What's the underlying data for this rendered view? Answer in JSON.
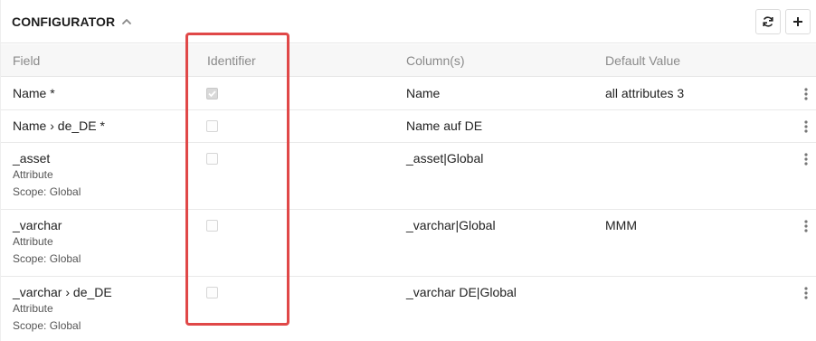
{
  "header": {
    "title": "CONFIGURATOR",
    "collapse_icon": "chevron-up-icon",
    "refresh_icon": "refresh-icon",
    "add_icon": "plus-icon"
  },
  "table": {
    "columns": [
      "Field",
      "Identifier",
      "Column(s)",
      "Default Value"
    ],
    "rows": [
      {
        "field": "Name *",
        "type": "",
        "scope": "",
        "identifier_checked": true,
        "columns": "Name",
        "default": "all attributes 3"
      },
      {
        "field": "Name › de_DE *",
        "type": "",
        "scope": "",
        "identifier_checked": false,
        "columns": "Name auf DE",
        "default": ""
      },
      {
        "field": "_asset",
        "type": "Attribute",
        "scope": "Scope: Global",
        "identifier_checked": false,
        "columns": "_asset|Global",
        "default": ""
      },
      {
        "field": "_varchar",
        "type": "Attribute",
        "scope": "Scope: Global",
        "identifier_checked": false,
        "columns": "_varchar|Global",
        "default": "MMM"
      },
      {
        "field": "_varchar › de_DE",
        "type": "Attribute",
        "scope": "Scope: Global",
        "identifier_checked": false,
        "columns": "_varchar DE|Global",
        "default": ""
      }
    ]
  },
  "colors": {
    "highlight": "#e04848",
    "header_bg": "#f7f7f7"
  }
}
